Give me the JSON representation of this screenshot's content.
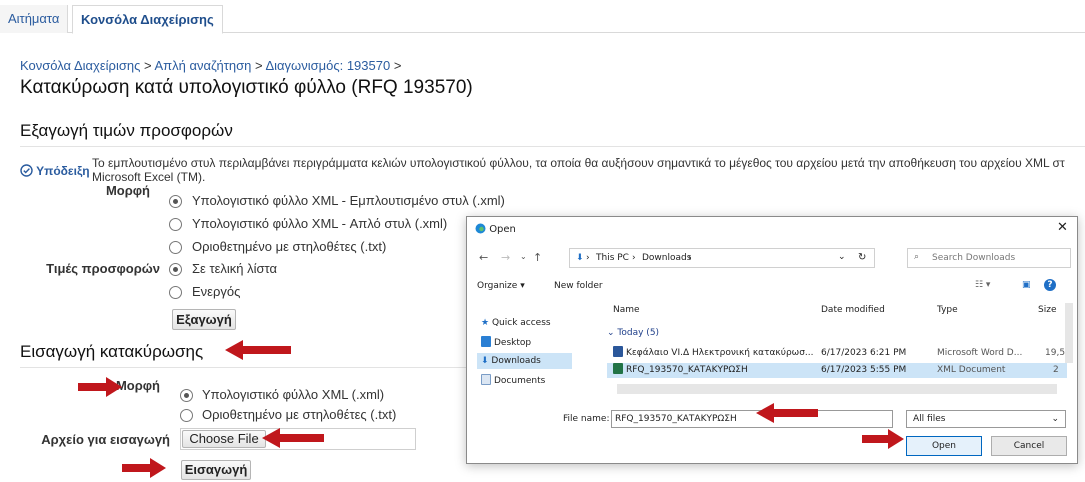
{
  "tabs": [
    {
      "label": "Αιτήματα"
    },
    {
      "label": "Κονσόλα Διαχείρισης"
    }
  ],
  "breadcrumb": {
    "items": [
      "Κονσόλα Διαχείρισης",
      "Απλή αναζήτηση",
      "Διαγωνισμός: 193570"
    ],
    "separator": ">"
  },
  "page_title": "Κατακύρωση κατά υπολογιστικό φύλλο (RFQ 193570)",
  "export_section": {
    "heading": "Εξαγωγή τιμών προσφορών",
    "hint_label": "Υπόδειξη",
    "hint_text_line1": "Το εμπλουτισμένο στυλ περιλαμβάνει περιγράμματα κελιών υπολογιστικού φύλλου, τα οποία θα αυξήσουν σημαντικά το μέγεθος του αρχείου μετά την αποθήκευση του αρχείου XML στ",
    "hint_text_line2": "Microsoft Excel (TM).",
    "format_label": "Μορφή",
    "format_options": [
      {
        "label": "Υπολογιστικό φύλλο XML - Εμπλουτισμένο στυλ (.xml)",
        "selected": true
      },
      {
        "label": "Υπολογιστικό φύλλο XML - Απλό στυλ (.xml)",
        "selected": false
      },
      {
        "label": "Οριοθετημένο με στηλοθέτες (.txt)",
        "selected": false
      }
    ],
    "prices_label": "Τιμές προσφορών",
    "prices_options": [
      {
        "label": "Σε τελική λίστα",
        "selected": true
      },
      {
        "label": "Ενεργός",
        "selected": false
      }
    ],
    "export_button": "Εξαγωγή"
  },
  "import_section": {
    "heading": "Εισαγωγή κατακύρωσης",
    "format_label": "Μορφή",
    "format_options": [
      {
        "label": "Υπολογιστικό φύλλο XML (.xml)",
        "selected": true
      },
      {
        "label": "Οριοθετημένο με στηλοθέτες (.txt)",
        "selected": false
      }
    ],
    "file_label": "Αρχείο για εισαγωγή",
    "choose_file_button": "Choose File",
    "import_button": "Εισαγωγή"
  },
  "open_dialog": {
    "title": "Open",
    "address_parts": [
      "This PC",
      "Downloads"
    ],
    "search_placeholder": "Search Downloads",
    "organize_label": "Organize",
    "new_folder_label": "New folder",
    "columns": [
      "Name",
      "Date modified",
      "Type",
      "Size"
    ],
    "group_label": "Today (5)",
    "nav_items": [
      "Quick access",
      "Desktop",
      "Downloads",
      "Documents"
    ],
    "files": [
      {
        "name": "Κεφάλαιο VI.Δ Ηλεκτρονική κατακύρωσ...",
        "date": "6/17/2023 6:21 PM",
        "type": "Microsoft Word D...",
        "size": "19,5",
        "selected": false
      },
      {
        "name": "RFQ_193570_ΚΑΤΑΚΥΡΩΣΗ",
        "date": "6/17/2023 5:55 PM",
        "type": "XML Document",
        "size": "2",
        "selected": true
      }
    ],
    "file_name_label": "File name:",
    "file_name_value": "RFQ_193570_ΚΑΤΑΚΥΡΩΣΗ",
    "file_type_value": "All files",
    "open_button": "Open",
    "cancel_button": "Cancel"
  },
  "colors": {
    "link": "#2b5c9f",
    "arrow": "#c0171c",
    "selection": "#cce4f7",
    "accent": "#0067c0"
  }
}
